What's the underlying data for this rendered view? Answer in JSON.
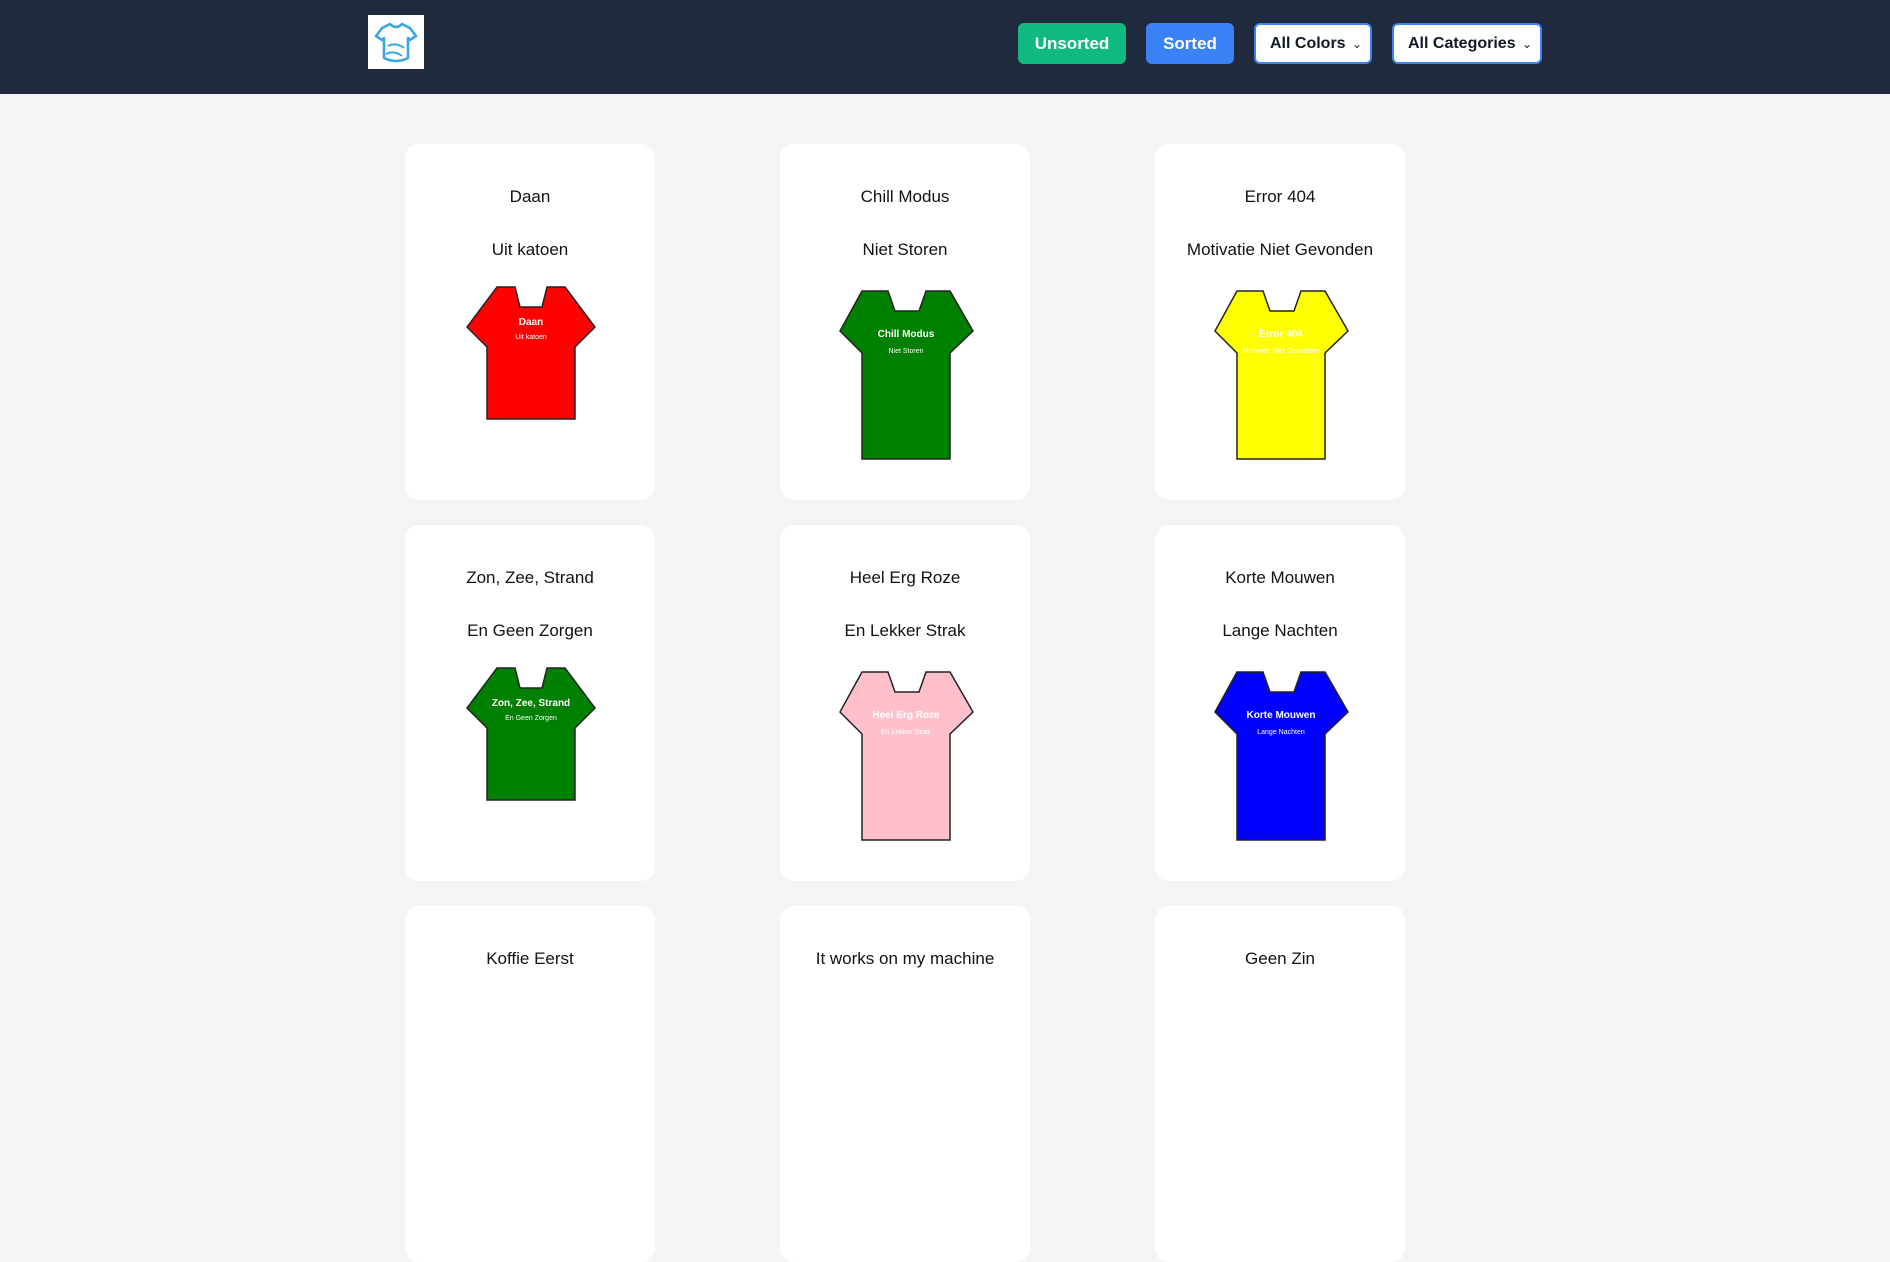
{
  "header": {
    "logo_icon": "tshirt-logo-icon",
    "unsorted_label": "Unsorted",
    "sorted_label": "Sorted",
    "color_select": "All Colors",
    "category_select": "All Categories",
    "colors": {
      "bar": "#1f2a3d",
      "unsorted": "#10b981",
      "sorted": "#3b82f6"
    }
  },
  "shirts": [
    {
      "line1": "Daan",
      "line2": "Uit katoen",
      "color": "#ff0000",
      "text_color": "#ffffff"
    },
    {
      "line1": "Chill Modus",
      "line2": "Niet Storen",
      "color": "#008000",
      "text_color": "#ffffff"
    },
    {
      "line1": "Error 404",
      "line2": "Motivatie Niet Gevonden",
      "color": "#ffff00",
      "text_color": "#ffffff"
    },
    {
      "line1": "Zon, Zee, Strand",
      "line2": "En Geen Zorgen",
      "color": "#008000",
      "text_color": "#ffffff"
    },
    {
      "line1": "Heel Erg Roze",
      "line2": "En Lekker Strak",
      "color": "#ffc0cb",
      "text_color": "#ffffff"
    },
    {
      "line1": "Korte Mouwen",
      "line2": "Lange Nachten",
      "color": "#0000ff",
      "text_color": "#ffffff"
    },
    {
      "line1": "Koffie Eerst",
      "line2": "",
      "color": "#ffffff",
      "text_color": "#ffffff"
    },
    {
      "line1": "It works on my machine",
      "line2": "",
      "color": "#ffffff",
      "text_color": "#ffffff"
    },
    {
      "line1": "Geen Zin",
      "line2": "",
      "color": "#ffffff",
      "text_color": "#ffffff"
    }
  ]
}
